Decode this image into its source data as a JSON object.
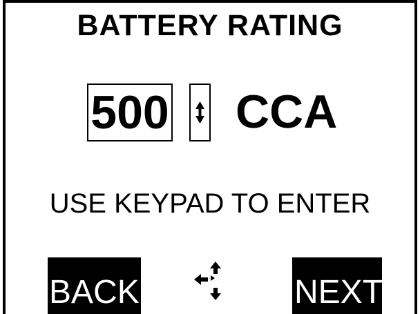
{
  "screen": {
    "title": "BATTERY RATING",
    "rating": {
      "value": "500",
      "unit": "CCA",
      "adjust_icon": "up-down-arrow-icon"
    },
    "instruction": "USE KEYPAD TO ENTER",
    "softkeys": {
      "back_label": "BACK",
      "next_label": "NEXT",
      "nav_icon": "four-way-navigation-icon"
    }
  },
  "colors": {
    "background": "#ffffff",
    "foreground": "#000000",
    "softkey_bg": "#000000",
    "softkey_text": "#ffffff"
  }
}
